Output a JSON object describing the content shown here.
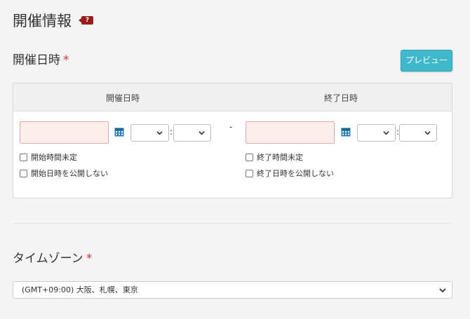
{
  "page": {
    "title": "開催情報",
    "help_badge": "?"
  },
  "datetime_section": {
    "title": "開催日時",
    "required_mark": "*",
    "preview_button": "プレビュー",
    "start": {
      "header": "開催日時",
      "date_value": "",
      "hour_value": "",
      "minute_value": "",
      "time_sep": ":",
      "checkbox_time_undecided": "開始時間未定",
      "checkbox_hide_date": "開始日時を公開しない"
    },
    "range_separator": "-",
    "end": {
      "header": "終了日時",
      "date_value": "",
      "hour_value": "",
      "minute_value": "",
      "time_sep": ":",
      "checkbox_time_undecided": "終了時間未定",
      "checkbox_hide_date": "終了日時を公開しない"
    }
  },
  "timezone_section": {
    "title": "タイムゾーン",
    "required_mark": "*",
    "selected": "(GMT+09:00) 大阪、札幌、東京"
  },
  "colors": {
    "accent": "#3fb8cc",
    "required": "#cc3333",
    "invalid_bg": "#fdeeee",
    "invalid_border": "#e8a8a8",
    "badge": "#9a1c1c"
  },
  "icons": [
    "help-icon",
    "calendar-icon",
    "chevron-down-icon"
  ]
}
